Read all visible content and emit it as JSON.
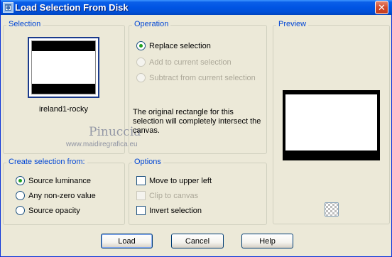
{
  "window": {
    "title": "Load Selection From Disk",
    "close_glyph": "✕"
  },
  "selection": {
    "label": "Selection",
    "thumbnail_caption": "ireland1-rocky"
  },
  "watermark": {
    "name": "Pinuccia",
    "url": "www.maidiregrafica.eu"
  },
  "operation": {
    "label": "Operation",
    "options": [
      {
        "label": "Replace selection",
        "selected": true,
        "enabled": true
      },
      {
        "label": "Add to current selection",
        "selected": false,
        "enabled": false
      },
      {
        "label": "Subtract from current selection",
        "selected": false,
        "enabled": false
      }
    ],
    "note": "The original rectangle for this selection will completely intersect the canvas."
  },
  "preview": {
    "label": "Preview"
  },
  "create_from": {
    "label": "Create selection from:",
    "options": [
      {
        "label": "Source luminance",
        "selected": true
      },
      {
        "label": "Any non-zero value",
        "selected": false
      },
      {
        "label": "Source opacity",
        "selected": false
      }
    ]
  },
  "options": {
    "label": "Options",
    "items": [
      {
        "label": "Move to upper left",
        "checked": false,
        "enabled": true
      },
      {
        "label": "Clip to canvas",
        "checked": false,
        "enabled": false
      },
      {
        "label": "Invert selection",
        "checked": false,
        "enabled": true
      }
    ]
  },
  "buttons": {
    "load": "Load",
    "cancel": "Cancel",
    "help": "Help"
  },
  "icons": {
    "title_icon": "load-selection-icon",
    "transparency_toggle": "checkerboard-icon"
  }
}
